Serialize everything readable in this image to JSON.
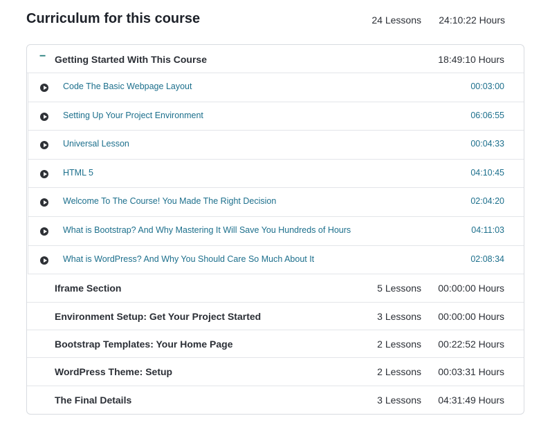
{
  "header": {
    "title": "Curriculum for this course",
    "lessons": "24 Lessons",
    "hours": "24:10:22 Hours"
  },
  "open_section": {
    "toggle": "−",
    "title": "Getting Started With This Course",
    "hours": "18:49:10 Hours",
    "lessons": [
      {
        "title": "Code The Basic Webpage Layout",
        "time": "00:03:00"
      },
      {
        "title": "Setting Up Your Project Environment",
        "time": "06:06:55"
      },
      {
        "title": "Universal Lesson",
        "time": "00:04:33"
      },
      {
        "title": "HTML 5",
        "time": "04:10:45"
      },
      {
        "title": "Welcome To The Course! You Made The Right Decision",
        "time": "02:04:20"
      },
      {
        "title": "What is Bootstrap? And Why Mastering It Will Save You Hundreds of Hours",
        "time": "04:11:03"
      },
      {
        "title": "What is WordPress? And Why You Should Care So Much About It",
        "time": "02:08:34"
      }
    ]
  },
  "sections": [
    {
      "title": "Iframe Section",
      "lessons": "5 Lessons",
      "hours": "00:00:00 Hours"
    },
    {
      "title": "Environment Setup: Get Your Project Started",
      "lessons": "3 Lessons",
      "hours": "00:00:00 Hours"
    },
    {
      "title": "Bootstrap Templates: Your Home Page",
      "lessons": "2 Lessons",
      "hours": "00:22:52 Hours"
    },
    {
      "title": "WordPress Theme: Setup",
      "lessons": "2 Lessons",
      "hours": "00:03:31 Hours"
    },
    {
      "title": "The Final Details",
      "lessons": "3 Lessons",
      "hours": "04:31:49 Hours"
    }
  ]
}
